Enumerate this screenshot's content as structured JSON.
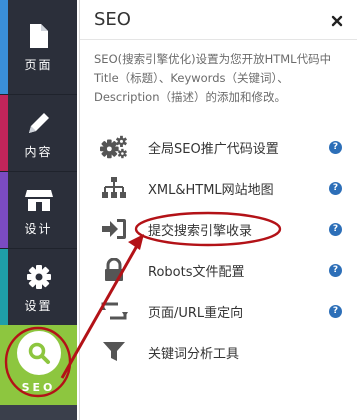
{
  "sidebar": {
    "items": [
      {
        "label": "页面",
        "icon": "page-icon",
        "color": "#3a8fd9"
      },
      {
        "label": "内容",
        "icon": "pencil-icon",
        "color": "#c0255a"
      },
      {
        "label": "设计",
        "icon": "store-icon",
        "color": "#7b4bc2"
      },
      {
        "label": "设置",
        "icon": "gear-icon",
        "color": "#1f9fa8"
      }
    ],
    "seo": {
      "label": "SEO",
      "icon": "search-icon",
      "color": "#8dc63f"
    }
  },
  "panel": {
    "title": "SEO",
    "close": "×",
    "description": "SEO(搜索引擎优化)设置为您开放HTML代码中Title（标题）、Keywords（关键词）、Description（描述）的添加和修改。",
    "items": [
      {
        "label": "全局SEO推广代码设置",
        "icon": "gears-icon",
        "help": "?"
      },
      {
        "label": "XML&HTML网站地图",
        "icon": "sitemap-icon",
        "help": "?"
      },
      {
        "label": "提交搜索引擎收录",
        "icon": "sign-in-icon",
        "help": "?"
      },
      {
        "label": "Robots文件配置",
        "icon": "lock-icon",
        "help": "?"
      },
      {
        "label": "页面/URL重定向",
        "icon": "retweet-icon",
        "help": "?"
      },
      {
        "label": "关键词分析工具",
        "icon": "filter-icon",
        "help": ""
      }
    ]
  },
  "annotation_color": "#b31217"
}
